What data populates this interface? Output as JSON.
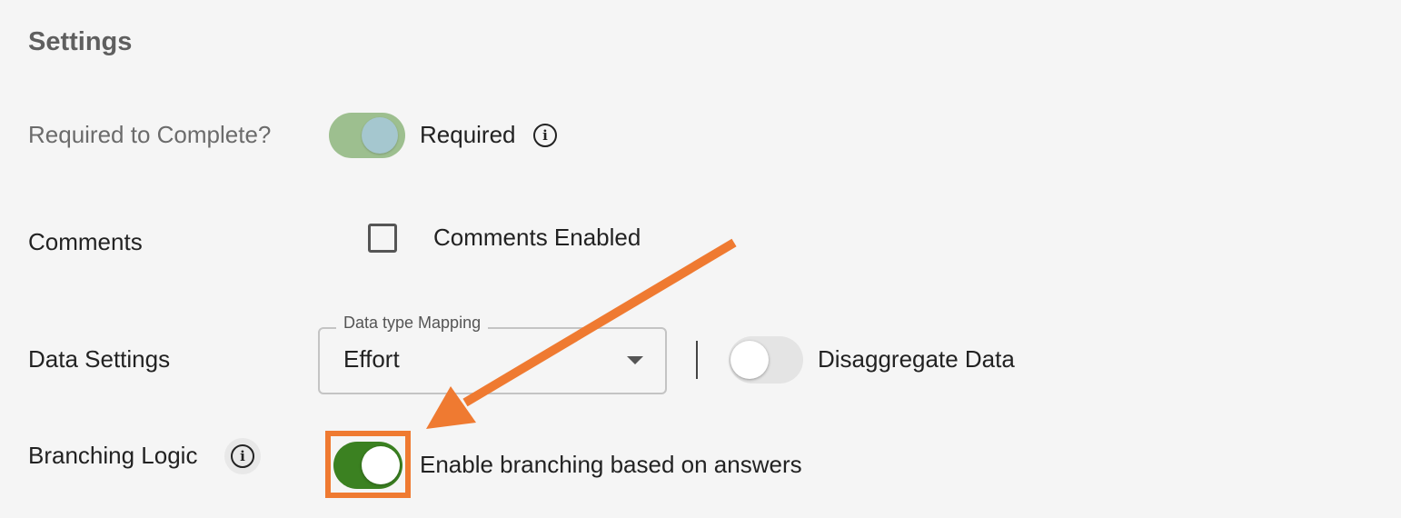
{
  "settings": {
    "title": "Settings",
    "required": {
      "row_label": "Required to Complete?",
      "toggle_on": true,
      "toggle_label": "Required"
    },
    "comments": {
      "row_label": "Comments",
      "checked": false,
      "checkbox_label": "Comments Enabled"
    },
    "data_settings": {
      "row_label": "Data Settings",
      "select_label": "Data type Mapping",
      "select_value": "Effort",
      "disaggregate_on": false,
      "disaggregate_label": "Disaggregate Data"
    },
    "branching": {
      "row_label": "Branching Logic",
      "toggle_on": true,
      "toggle_label": "Enable branching based on answers"
    }
  },
  "colors": {
    "annotation_orange": "#ef7a31",
    "toggle_green": "#3b8121",
    "disabled_toggle_green": "#9dbf8f"
  }
}
